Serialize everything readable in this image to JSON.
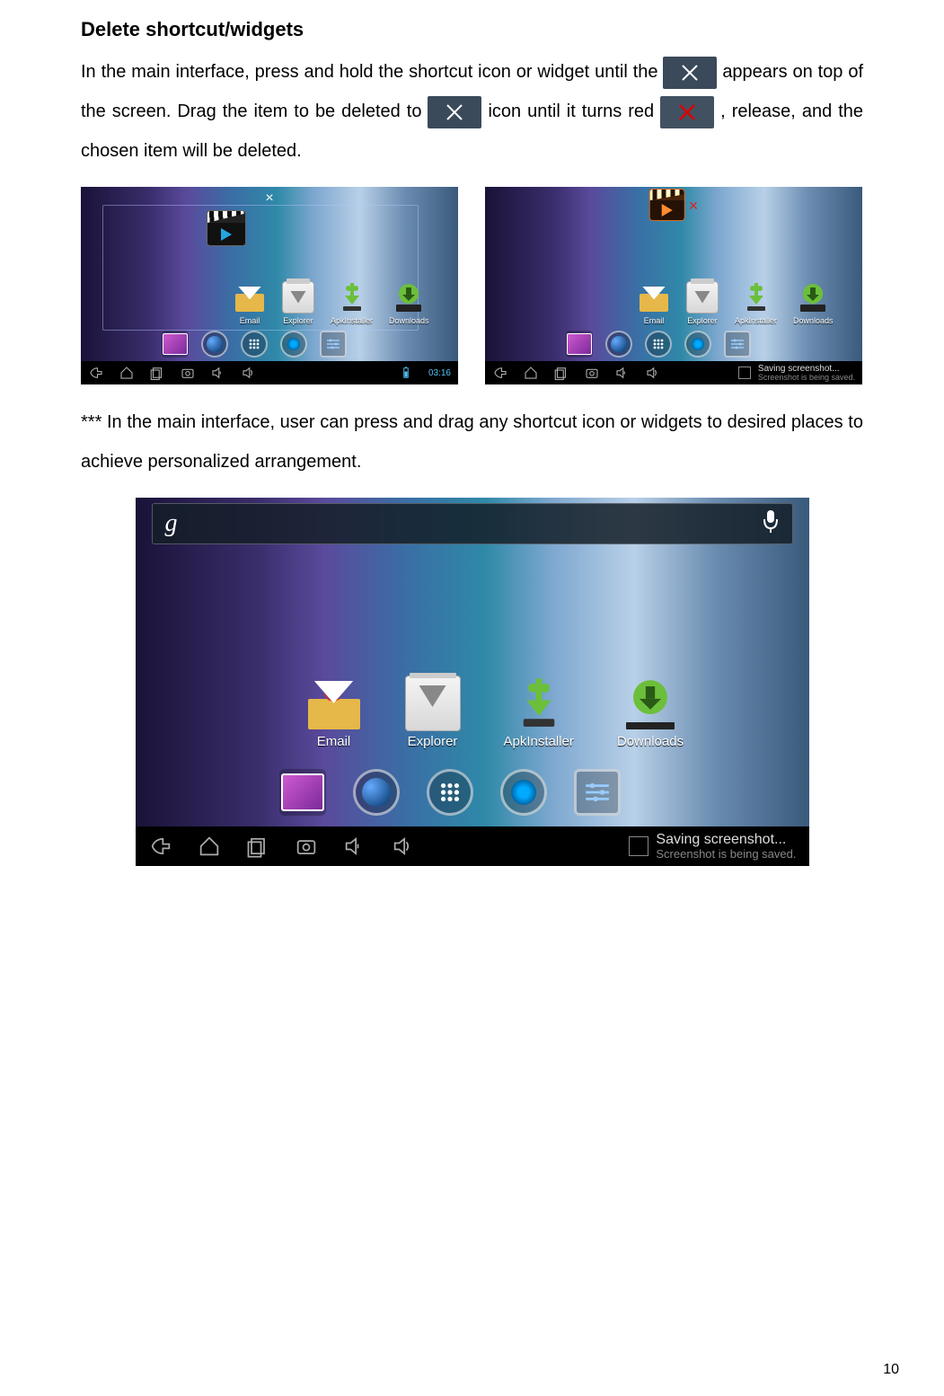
{
  "heading": "Delete shortcut/widgets",
  "para1": {
    "s1": "In  the main  interface, press and hold the shortcut icon or widget until the ",
    "s2": " appears on top of the screen. Drag the item to be deleted to ",
    "s3": " icon until it turns red ",
    "s4": " , release, and the chosen item will be deleted."
  },
  "para2": "*** In the main interface, user can press and drag any shortcut icon or widgets to desired places to achieve personalized arrangement.",
  "delete_label": "×",
  "apps": {
    "email": "Email",
    "explorer": "Explorer",
    "apk": "ApkInstaller",
    "downloads": "Downloads"
  },
  "toast": {
    "title": "Saving screenshot...",
    "sub": "Screenshot is being saved."
  },
  "clock": "03:16",
  "search": {
    "g": "g"
  },
  "page_number": "10"
}
